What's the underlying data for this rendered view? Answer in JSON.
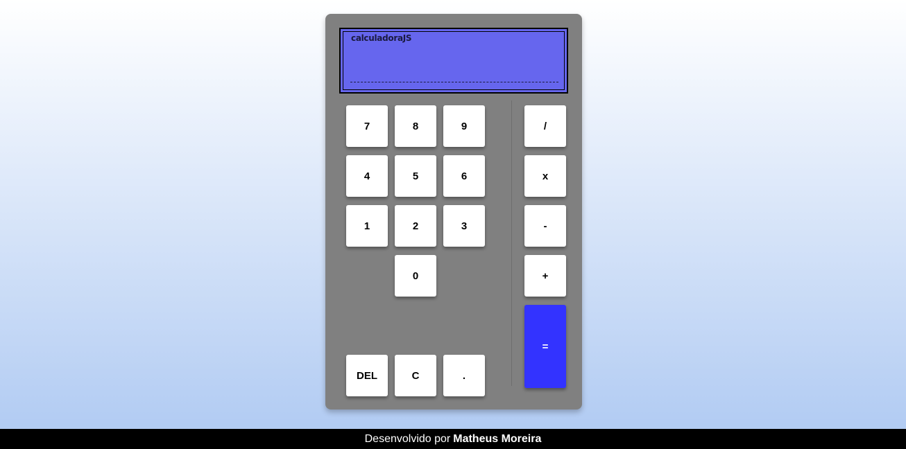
{
  "display": {
    "title": "calculadoraJS",
    "result": ""
  },
  "keys": {
    "seven": "7",
    "eight": "8",
    "nine": "9",
    "four": "4",
    "five": "5",
    "six": "6",
    "one": "1",
    "two": "2",
    "three": "3",
    "zero": "0",
    "del": "DEL",
    "clear": "C",
    "dot": ".",
    "divide": "/",
    "multiply": "x",
    "minus": "-",
    "plus": "+",
    "equals": "="
  },
  "footer": {
    "prefix": "Desenvolvido por",
    "author": "Matheus Moreira"
  },
  "colors": {
    "calculator_body": "#808080",
    "display_bg": "#6666ee",
    "equals_bg": "#3333ff",
    "footer_bg": "#000000"
  }
}
